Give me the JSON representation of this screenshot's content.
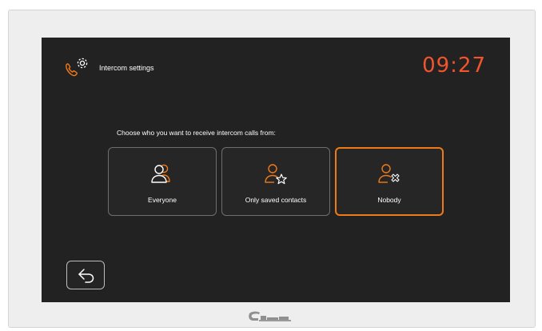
{
  "header": {
    "title": "Intercom settings",
    "icon": "phone-gear-icon",
    "time": "09:27"
  },
  "prompt": "Choose who you want to receive intercom calls from:",
  "options": [
    {
      "label": "Everyone",
      "icon": "users-icon",
      "selected": false
    },
    {
      "label": "Only saved contacts",
      "icon": "user-star-icon",
      "selected": false
    },
    {
      "label": "Nobody",
      "icon": "user-x-icon",
      "selected": true
    }
  ],
  "back": {
    "icon": "back-arrow-icon"
  },
  "colors": {
    "accent": "#f07a17",
    "clock": "#f2542d",
    "screen_bg": "#222222",
    "text": "#ffffff",
    "bezel": "#eeeeee"
  }
}
